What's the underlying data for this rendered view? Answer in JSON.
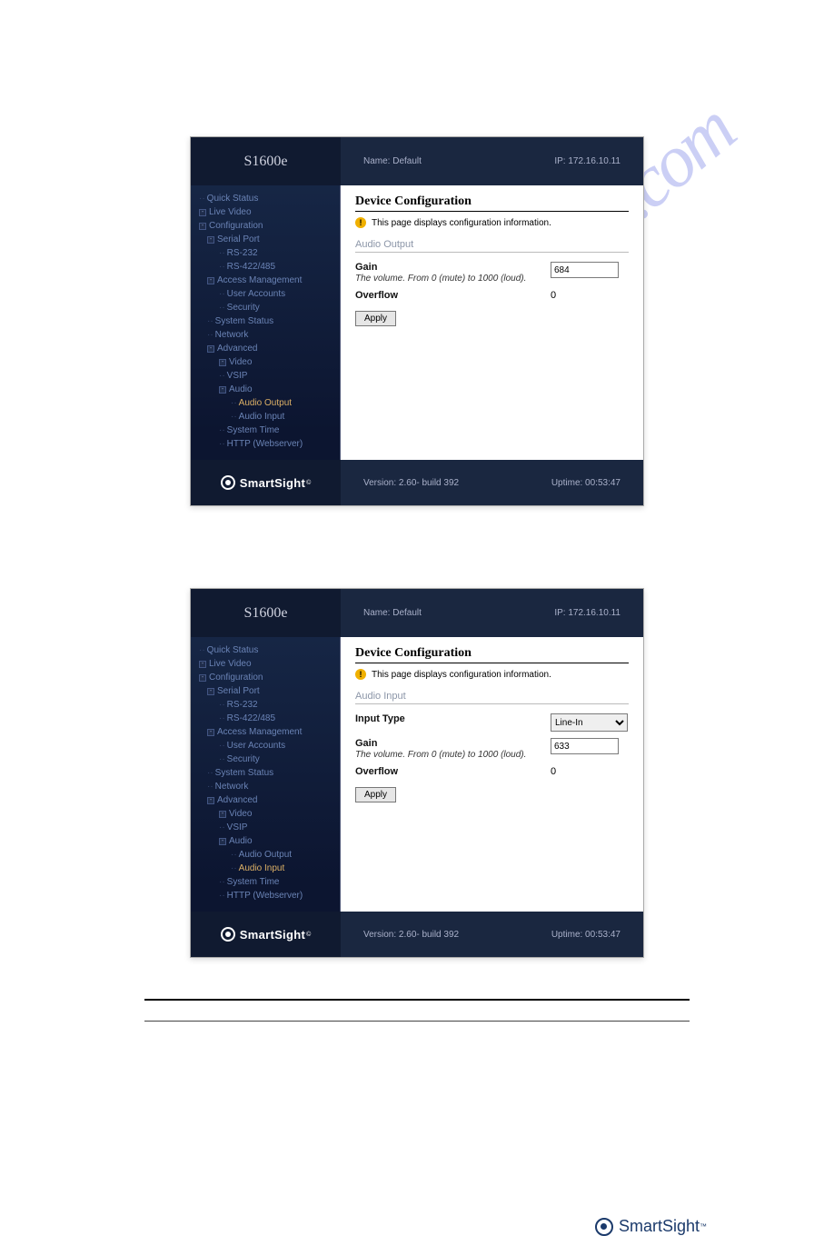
{
  "watermark_text": "manualsarchive.com",
  "panels": [
    {
      "header": {
        "model": "S1600e",
        "name_label": "Name:",
        "name": "Default",
        "ip_label": "IP:",
        "ip": "172.16.10.11"
      },
      "footer": {
        "brand": "SmartSight",
        "sup": "©",
        "version_label": "Version:",
        "version": "2.60- build 392",
        "uptime_label": "Uptime:",
        "uptime": "00:53:47"
      },
      "nav": [
        {
          "lvl": 1,
          "pre": "d",
          "txt": "Quick Status",
          "act": false
        },
        {
          "lvl": 1,
          "pre": "b",
          "txt": "Live Video",
          "act": false
        },
        {
          "lvl": 1,
          "pre": "b",
          "txt": "Configuration",
          "act": false
        },
        {
          "lvl": 2,
          "pre": "b",
          "txt": "Serial Port",
          "act": false
        },
        {
          "lvl": 3,
          "pre": "d",
          "txt": "RS-232",
          "act": false
        },
        {
          "lvl": 3,
          "pre": "d",
          "txt": "RS-422/485",
          "act": false
        },
        {
          "lvl": 2,
          "pre": "b",
          "txt": "Access Management",
          "act": false
        },
        {
          "lvl": 3,
          "pre": "d",
          "txt": "User Accounts",
          "act": false
        },
        {
          "lvl": 3,
          "pre": "d",
          "txt": "Security",
          "act": false
        },
        {
          "lvl": 2,
          "pre": "d",
          "txt": "System Status",
          "act": false
        },
        {
          "lvl": 2,
          "pre": "d",
          "txt": "Network",
          "act": false
        },
        {
          "lvl": 2,
          "pre": "b",
          "txt": "Advanced",
          "act": false
        },
        {
          "lvl": 3,
          "pre": "b",
          "txt": "Video",
          "act": false
        },
        {
          "lvl": 3,
          "pre": "d",
          "txt": "VSIP",
          "act": false
        },
        {
          "lvl": 3,
          "pre": "b",
          "txt": "Audio",
          "act": false
        },
        {
          "lvl": 4,
          "pre": "d",
          "txt": "Audio Output",
          "act": true
        },
        {
          "lvl": 4,
          "pre": "d",
          "txt": "Audio Input",
          "act": false
        },
        {
          "lvl": 3,
          "pre": "d",
          "txt": "System Time",
          "act": false
        },
        {
          "lvl": 3,
          "pre": "d",
          "txt": "HTTP (Webserver)",
          "act": false
        }
      ],
      "content": {
        "title": "Device Configuration",
        "info": "This page displays configuration information.",
        "section": "Audio Output",
        "fields": [
          {
            "label": "Gain",
            "hint": "The volume. From 0 (mute) to 1000 (loud).",
            "type": "text",
            "value": "684"
          },
          {
            "label": "Overflow",
            "hint": "",
            "type": "static",
            "value": "0"
          }
        ],
        "apply": "Apply"
      }
    },
    {
      "header": {
        "model": "S1600e",
        "name_label": "Name:",
        "name": "Default",
        "ip_label": "IP:",
        "ip": "172.16.10.11"
      },
      "footer": {
        "brand": "SmartSight",
        "sup": "©",
        "version_label": "Version:",
        "version": "2.60- build 392",
        "uptime_label": "Uptime:",
        "uptime": "00:53:47"
      },
      "nav": [
        {
          "lvl": 1,
          "pre": "d",
          "txt": "Quick Status",
          "act": false
        },
        {
          "lvl": 1,
          "pre": "b",
          "txt": "Live Video",
          "act": false
        },
        {
          "lvl": 1,
          "pre": "b",
          "txt": "Configuration",
          "act": false
        },
        {
          "lvl": 2,
          "pre": "b",
          "txt": "Serial Port",
          "act": false
        },
        {
          "lvl": 3,
          "pre": "d",
          "txt": "RS-232",
          "act": false
        },
        {
          "lvl": 3,
          "pre": "d",
          "txt": "RS-422/485",
          "act": false
        },
        {
          "lvl": 2,
          "pre": "b",
          "txt": "Access Management",
          "act": false
        },
        {
          "lvl": 3,
          "pre": "d",
          "txt": "User Accounts",
          "act": false
        },
        {
          "lvl": 3,
          "pre": "d",
          "txt": "Security",
          "act": false
        },
        {
          "lvl": 2,
          "pre": "d",
          "txt": "System Status",
          "act": false
        },
        {
          "lvl": 2,
          "pre": "d",
          "txt": "Network",
          "act": false
        },
        {
          "lvl": 2,
          "pre": "b",
          "txt": "Advanced",
          "act": false
        },
        {
          "lvl": 3,
          "pre": "b",
          "txt": "Video",
          "act": false
        },
        {
          "lvl": 3,
          "pre": "d",
          "txt": "VSIP",
          "act": false
        },
        {
          "lvl": 3,
          "pre": "b",
          "txt": "Audio",
          "act": false
        },
        {
          "lvl": 4,
          "pre": "d",
          "txt": "Audio Output",
          "act": false
        },
        {
          "lvl": 4,
          "pre": "d",
          "txt": "Audio Input",
          "act": true
        },
        {
          "lvl": 3,
          "pre": "d",
          "txt": "System Time",
          "act": false
        },
        {
          "lvl": 3,
          "pre": "d",
          "txt": "HTTP (Webserver)",
          "act": false
        }
      ],
      "content": {
        "title": "Device Configuration",
        "info": "This page displays configuration information.",
        "section": "Audio Input",
        "fields": [
          {
            "label": "Input Type",
            "hint": "",
            "type": "select",
            "value": "Line-In"
          },
          {
            "label": "Gain",
            "hint": "The volume. From 0 (mute) to 1000 (loud).",
            "type": "text",
            "value": "633"
          },
          {
            "label": "Overflow",
            "hint": "",
            "type": "static",
            "value": "0"
          }
        ],
        "apply": "Apply"
      }
    }
  ],
  "page_brand": {
    "text": "SmartSight",
    "tm": "™"
  }
}
